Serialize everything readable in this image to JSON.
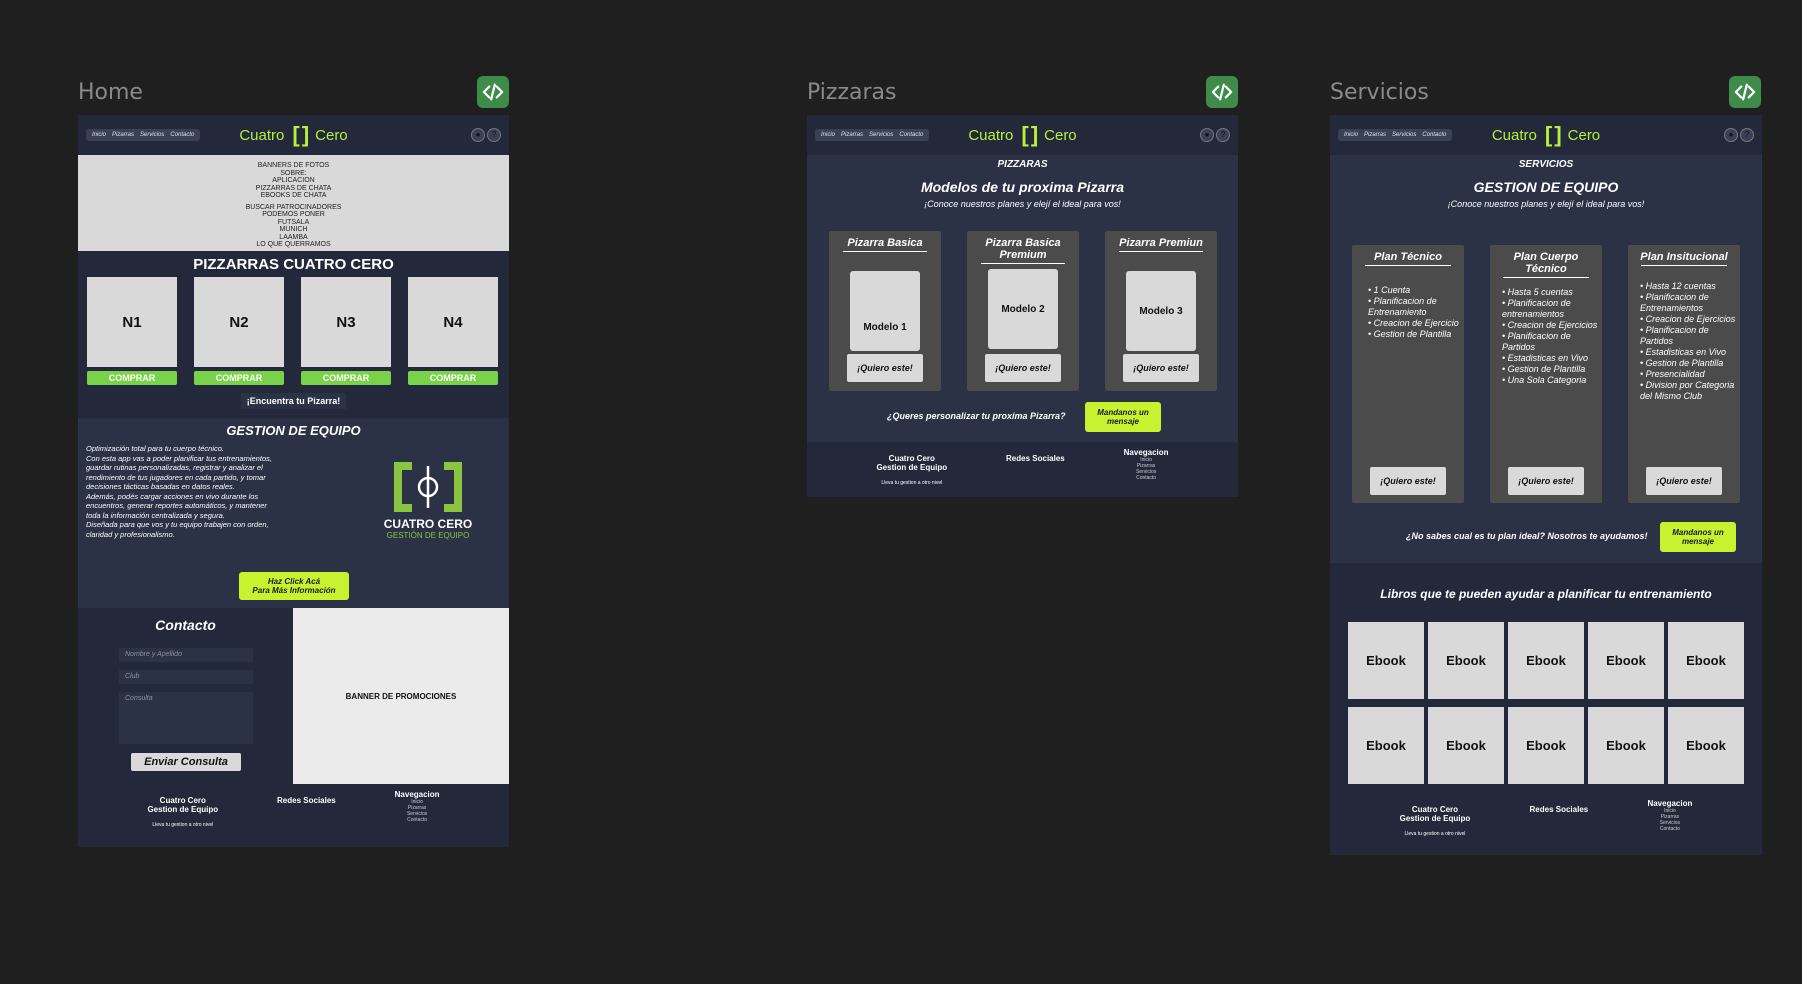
{
  "frames": {
    "home": "Home",
    "pizzaras": "Pizzaras",
    "servicios": "Servicios"
  },
  "nav": {
    "links": [
      "Inicio",
      "Pizarras",
      "Servicios",
      "Contacto"
    ],
    "brand_left": "Cuatro",
    "brand_right": "Cero",
    "brand_mark": "[ ]"
  },
  "home": {
    "banner_lines": [
      "BANNERS DE FOTOS",
      "SOBRE:",
      "APLICACION",
      "PIZZARRAS DE CHATA",
      "EBOOKS DE CHATA",
      "BUSCAR PATROCINADORES",
      "PODEMOS PONER",
      "FUTSALA",
      "MUNICH",
      "LAAMBA",
      "LO QUE QUERRAMOS"
    ],
    "pizarras_title": "PIZZARRAS CUATRO CERO",
    "products": [
      "N1",
      "N2",
      "N3",
      "N4"
    ],
    "buy_label": "COMPRAR",
    "find_button": "¡Encuentra tu Pizarra!",
    "gestion_title": "GESTION DE EQUIPO",
    "gestion_text": "Optimización total para tu cuerpo técnico.\n Con esta app vas a poder planificar tus entrenamientos, guardar rutinas personalizadas, registrar y analizar el rendimiento de tus jugadores en cada partido, y tomar decisiones tácticas basadas en datos reales.\n Además, podés cargar acciones en vivo durante los encuentros, generar reportes automáticos, y mantener toda la información centralizada y segura.\n Diseñada para que vos y tu equipo trabajen con orden, claridad y profesionalismo.",
    "logo_line1": "CUATRO CERO",
    "logo_line2": "GESTIÓN DE EQUIPO",
    "click_button": "Haz Click Acá\nPara Más Información",
    "contact_title": "Contacto",
    "field_name": "Nombre y Apellido",
    "field_club": "Club",
    "field_consulta": "Consulta",
    "send_button": "Enviar Consulta",
    "promo_banner": "BANNER DE PROMOCIONES"
  },
  "footer": {
    "brand_line1": "Cuatro Cero",
    "brand_line2": "Gestion de Equipo",
    "tagline": "Lleva tu gestion a otro nivel",
    "social": "Redes Sociales",
    "nav_title": "Navegacion",
    "nav_links": [
      "Inicio",
      "Pizarras",
      "Servicios",
      "Contacto"
    ]
  },
  "pizarras": {
    "section": "PIZZARAS",
    "title": "Modelos de tu proxima Pizarra",
    "subtitle": "¡Conoce nuestros planes y elejí el ideal para vos!",
    "plans": [
      {
        "name": "Pizarra Basica",
        "model": "Modelo 1"
      },
      {
        "name": "Pizarra Basica Premium",
        "model": "Modelo 2"
      },
      {
        "name": "Pizarra Premiun",
        "model": "Modelo 3"
      }
    ],
    "cta": "¡Quiero este!",
    "custom_q": "¿Queres personalizar tu proxima Pizarra?",
    "message_button": "Mandanos un mensaje"
  },
  "servicios": {
    "section": "SERVICIOS",
    "title": "GESTION DE EQUIPO",
    "subtitle": "¡Conoce nuestros planes y elejí el ideal para vos!",
    "plans": [
      {
        "name": "Plan Técnico",
        "features": [
          "1 Cuenta",
          "Planificacion de Entrenamiento",
          "Creacion de Ejercicio",
          "Gestion de Plantilla"
        ]
      },
      {
        "name": "Plan Cuerpo Técnico",
        "features": [
          "Hasta 5 cuentas",
          "Planificacion de entrenamientos",
          "Creacion de Ejercicios",
          "Planificacion de Partidos",
          "Estadisticas en Vivo",
          "Gestion de Plantilla",
          "Una Sola Categoria"
        ]
      },
      {
        "name": "Plan Insitucional",
        "features": [
          "Hasta 12 cuentas",
          "Planificacion de Entrenamientos",
          "Creacion de Ejercicios",
          "Planificacion de Partidos",
          "Estadisticas en Vivo",
          "Gestion de Plantilla",
          "Presencialidad",
          "Division por Categoria del Mismo Club"
        ]
      }
    ],
    "cta": "¡Quiero este!",
    "help_text": "¿No sabes cual es tu plan ideal? Nosotros te ayudamos!",
    "message_button": "Mandanos un mensaje",
    "books_title": "Libros que te pueden ayudar a planificar tu entrenamiento",
    "ebook_label": "Ebook"
  },
  "colors": {
    "lime": "#c7f230",
    "green": "#7ad24a",
    "bg_frame": "#23293a",
    "canvas": "#1f1f1f"
  }
}
